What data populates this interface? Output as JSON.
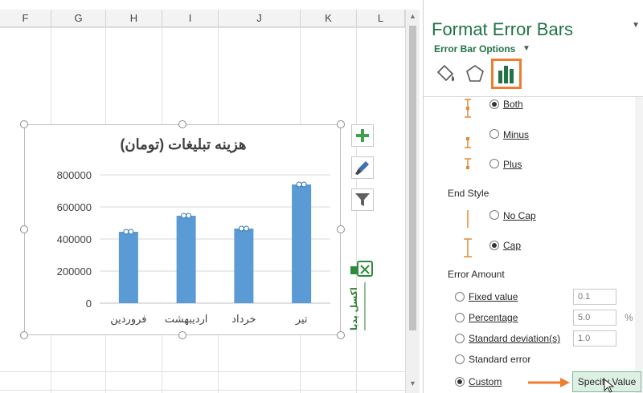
{
  "sheet": {
    "columns": [
      "F",
      "G",
      "H",
      "I",
      "J",
      "K",
      "L"
    ]
  },
  "chart": {
    "title": "هزینه تبلیغات (تومان)",
    "side_buttons": [
      "plus-icon",
      "brush-icon",
      "filter-icon"
    ]
  },
  "chart_data": {
    "type": "bar",
    "title": "هزینه تبلیغات (تومان)",
    "categories": [
      "فروردین",
      "اردیبهشت",
      "خرداد",
      "تیر"
    ],
    "values": [
      445000,
      545000,
      465000,
      740000
    ],
    "ylim": [
      0,
      800000
    ],
    "y_ticks": [
      "0",
      "200000",
      "400000",
      "600000",
      "800000"
    ],
    "grid": true,
    "bar_color": "#5b9bd5",
    "error_bars": "cap"
  },
  "logo": {
    "name": "اکسل پدیا"
  },
  "pane": {
    "title": "Format Error Bars",
    "subtitle": "Error Bar Options",
    "direction": {
      "options": [
        {
          "label": "Both",
          "checked": true
        },
        {
          "label": "Minus",
          "checked": false
        },
        {
          "label": "Plus",
          "checked": false
        }
      ]
    },
    "end_style": {
      "heading": "End Style",
      "options": [
        {
          "label": "No Cap",
          "checked": false
        },
        {
          "label": "Cap",
          "checked": true
        }
      ]
    },
    "error_amount": {
      "heading": "Error Amount",
      "fixed_value": {
        "label": "Fixed value",
        "value": "0.1"
      },
      "percentage": {
        "label": "Percentage",
        "value": "5.0",
        "unit": "%"
      },
      "std_dev": {
        "label": "Standard deviation(s)",
        "value": "1.0"
      },
      "std_error": {
        "label": "Standard error"
      },
      "custom": {
        "label": "Custom",
        "checked": true
      },
      "specify_button": "Specify Value"
    }
  },
  "colors": {
    "accent_green": "#217346",
    "highlight_orange": "#ed7d31",
    "bar_blue": "#5b9bd5"
  }
}
